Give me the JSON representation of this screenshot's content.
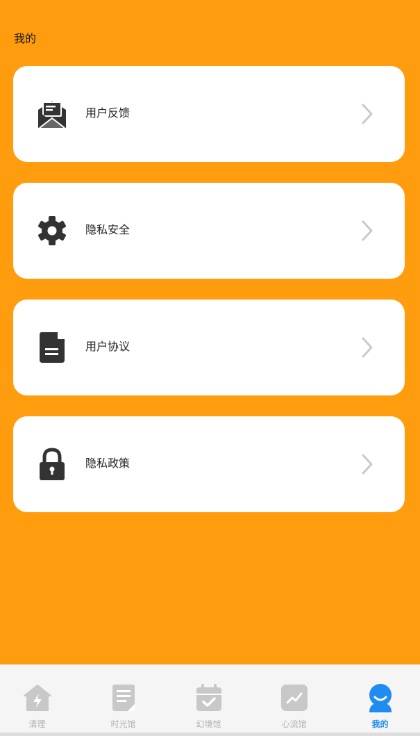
{
  "page": {
    "title": "我的"
  },
  "menu": [
    {
      "label": "用户反馈",
      "icon": "envelope-open-icon"
    },
    {
      "label": "隐私安全",
      "icon": "gear-icon"
    },
    {
      "label": "用户协议",
      "icon": "document-icon"
    },
    {
      "label": "隐私政策",
      "icon": "lock-icon"
    }
  ],
  "tabbar": {
    "items": [
      {
        "label": "清理",
        "icon": "house-bolt-icon",
        "active": false
      },
      {
        "label": "时光馆",
        "icon": "notepad-icon",
        "active": false
      },
      {
        "label": "幻境馆",
        "icon": "calendar-check-icon",
        "active": false
      },
      {
        "label": "心流馆",
        "icon": "trend-chart-icon",
        "active": false
      },
      {
        "label": "我的",
        "icon": "profile-face-icon",
        "active": true
      }
    ]
  },
  "colors": {
    "background": "#FF9D0E",
    "card": "#FFFFFF",
    "icon_dark": "#333333",
    "tab_active": "#1E8CF0",
    "tab_inactive": "#C8C8C8"
  }
}
